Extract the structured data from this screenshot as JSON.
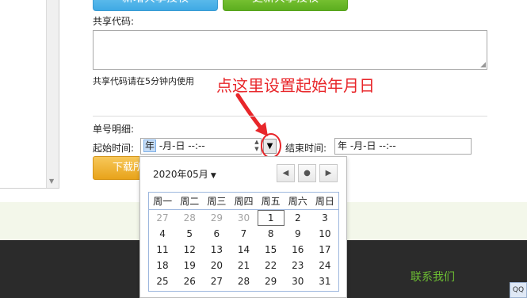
{
  "top_buttons": {
    "blue_label": "新增共享授权",
    "green_label": "更新共享授权"
  },
  "share_code": {
    "label": "共享代码:",
    "value": "",
    "hint": "共享代码请在5分钟内使用"
  },
  "annotation": {
    "text": "点这里设置起始年月日",
    "color": "#e8262a"
  },
  "detail": {
    "section_label": "单号明细:",
    "start_label": "起始时间:",
    "start_value": {
      "year": "年",
      "rest": " -月-日  --:--"
    },
    "dropdown_icon": "▼",
    "end_label": "结束时间:",
    "end_value": "年 -月-日  --:--"
  },
  "download_button": {
    "label": "下载所"
  },
  "calendar": {
    "month_label": "2020年05月",
    "caret": "▼",
    "nav": {
      "prev": "◀",
      "today": "●",
      "next": "▶"
    },
    "weekdays": [
      "周一",
      "周二",
      "周三",
      "周四",
      "周五",
      "周六",
      "周日"
    ],
    "weeks": [
      [
        "27",
        "28",
        "29",
        "30",
        "1",
        "2",
        "3"
      ],
      [
        "4",
        "5",
        "6",
        "7",
        "8",
        "9",
        "10"
      ],
      [
        "11",
        "12",
        "13",
        "14",
        "15",
        "16",
        "17"
      ],
      [
        "18",
        "19",
        "20",
        "21",
        "22",
        "23",
        "24"
      ],
      [
        "25",
        "26",
        "27",
        "28",
        "29",
        "30",
        "31"
      ]
    ],
    "selected_day": "1"
  },
  "footer": {
    "contact": "联系我们",
    "contact_color": "#6dbe33",
    "badge_icon": "qq-icon"
  },
  "colors": {
    "accent_red": "#e8262a",
    "download_orange": "#e8a31a",
    "footer_dark": "#2b2b2b"
  }
}
